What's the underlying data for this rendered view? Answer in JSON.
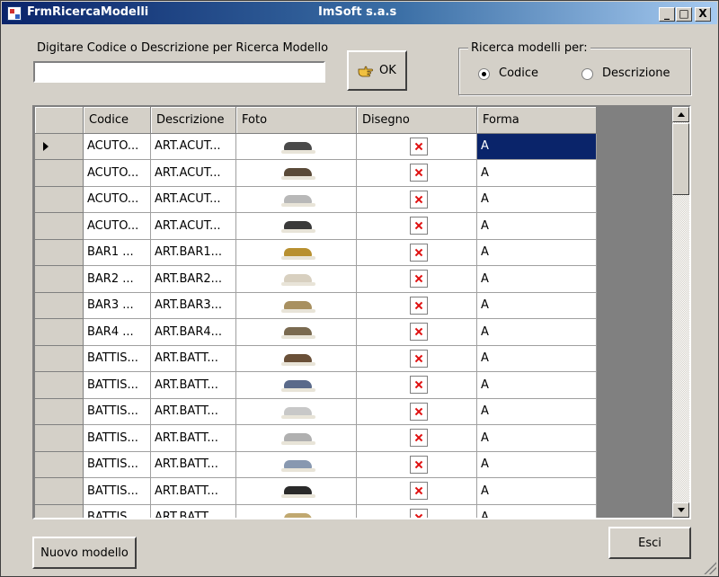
{
  "window": {
    "title": "FrmRicercaModelli",
    "company": "ImSoft s.a.s",
    "minimize_glyph": "_",
    "maximize_glyph": "□",
    "close_glyph": "X"
  },
  "search": {
    "label": "Digitare Codice o Descrizione per Ricerca Modello",
    "value": "",
    "ok_label": "OK"
  },
  "search_mode": {
    "legend": "Ricerca modelli per:",
    "options": [
      {
        "label": "Codice",
        "checked": true
      },
      {
        "label": "Descrizione",
        "checked": false
      }
    ]
  },
  "grid": {
    "columns": [
      "Codice",
      "Descrizione",
      "Foto",
      "Disegno",
      "Forma"
    ],
    "rows": [
      {
        "codice": "ACUTO...",
        "descrizione": "ART.ACUT...",
        "forma": "A",
        "shoe": "#4a4a4a"
      },
      {
        "codice": "ACUTO...",
        "descrizione": "ART.ACUT...",
        "forma": "A",
        "shoe": "#5a4a38"
      },
      {
        "codice": "ACUTO...",
        "descrizione": "ART.ACUT...",
        "forma": "A",
        "shoe": "#b8b8b8"
      },
      {
        "codice": "ACUTO...",
        "descrizione": "ART.ACUT...",
        "forma": "A",
        "shoe": "#3a3a3a"
      },
      {
        "codice": "BAR1    ...",
        "descrizione": "ART.BAR1...",
        "forma": "A",
        "shoe": "#b89030"
      },
      {
        "codice": "BAR2    ...",
        "descrizione": "ART.BAR2...",
        "forma": "A",
        "shoe": "#d8d0c0"
      },
      {
        "codice": "BAR3    ...",
        "descrizione": "ART.BAR3...",
        "forma": "A",
        "shoe": "#a89060"
      },
      {
        "codice": "BAR4    ...",
        "descrizione": "ART.BAR4...",
        "forma": "A",
        "shoe": "#7a6a50"
      },
      {
        "codice": "BATTIS...",
        "descrizione": "ART.BATT...",
        "forma": "A",
        "shoe": "#6a5038"
      },
      {
        "codice": "BATTIS...",
        "descrizione": "ART.BATT...",
        "forma": "A",
        "shoe": "#5a6a8a"
      },
      {
        "codice": "BATTIS...",
        "descrizione": "ART.BATT...",
        "forma": "A",
        "shoe": "#c8c8c8"
      },
      {
        "codice": "BATTIS...",
        "descrizione": "ART.BATT...",
        "forma": "A",
        "shoe": "#b0b0b0"
      },
      {
        "codice": "BATTIS...",
        "descrizione": "ART.BATT...",
        "forma": "A",
        "shoe": "#8898b0"
      },
      {
        "codice": "BATTIS...",
        "descrizione": "ART.BATT...",
        "forma": "A",
        "shoe": "#2a2a2a"
      },
      {
        "codice": "BATTIS...",
        "descrizione": "ART.BATT...",
        "forma": "A",
        "shoe": "#c0a870"
      }
    ],
    "selected_row": 0
  },
  "footer": {
    "new_model_label": "Nuovo modello",
    "exit_label": "Esci"
  }
}
